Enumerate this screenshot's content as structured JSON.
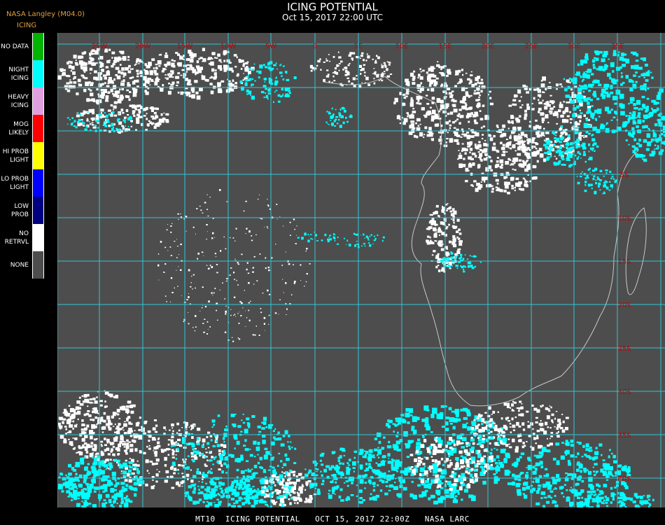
{
  "header": {
    "source_label": "NASA Langley (M04.0)",
    "product_label": "ICING",
    "title": "ICING POTENTIAL",
    "timestamp": "Oct 15, 2017 22:00 UTC"
  },
  "legend": [
    {
      "label_lines": [
        "NO DATA"
      ],
      "color": "#00b400"
    },
    {
      "label_lines": [
        "NIGHT",
        "ICING"
      ],
      "color": "#00ffff"
    },
    {
      "label_lines": [
        "HEAVY",
        "ICING"
      ],
      "color": "#e0a0e0"
    },
    {
      "label_lines": [
        "MOG",
        "LIKELY"
      ],
      "color": "#ff0000"
    },
    {
      "label_lines": [
        "HI PROB",
        "LIGHT"
      ],
      "color": "#ffff00"
    },
    {
      "label_lines": [
        "LO PROB",
        "LIGHT"
      ],
      "color": "#0000ff"
    },
    {
      "label_lines": [
        "LOW",
        "PROB"
      ],
      "color": "#000080"
    },
    {
      "label_lines": [
        "NO",
        "RETRVL"
      ],
      "color": "#ffffff"
    },
    {
      "label_lines": [
        "NONE"
      ],
      "color": "#4d4d4d"
    }
  ],
  "map": {
    "background_color": "#4d4d4d",
    "grid_color": "#30c8d8",
    "label_color": "#c80000",
    "longitude_labels": [
      "25W",
      "20W",
      "15W",
      "10W",
      "5W",
      "0",
      "5E",
      "10E",
      "15E",
      "20E",
      "25E",
      "30E",
      "35E"
    ],
    "latitude_labels": [
      "5S",
      "10S",
      "15S",
      "20S",
      "25S",
      "30S",
      "35S",
      "40S"
    ]
  },
  "footer": {
    "text": "MT10  ICING POTENTIAL   OCT 15, 2017 22:00Z   NASA LARC"
  }
}
